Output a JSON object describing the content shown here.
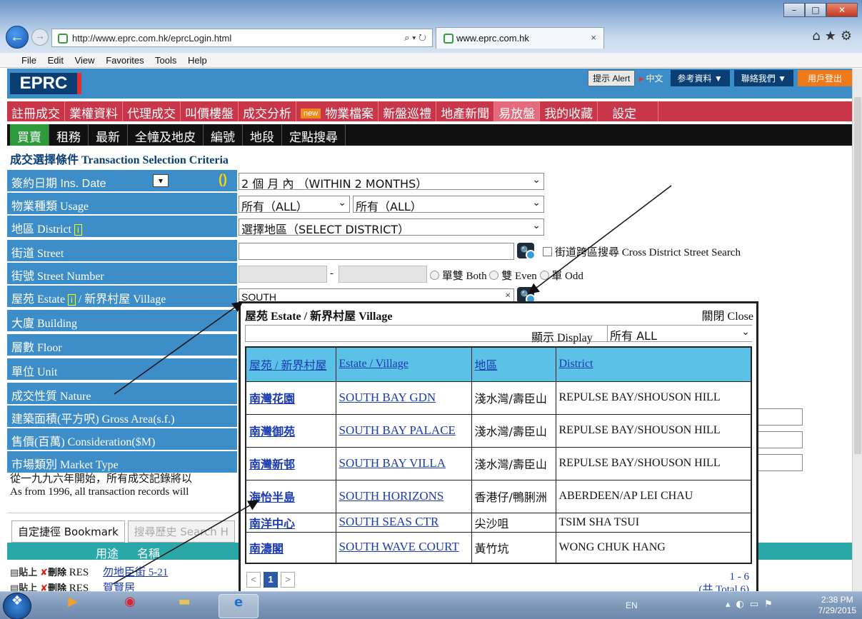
{
  "browser": {
    "url": "http://www.eprc.com.hk/eprcLogin.html",
    "tab_title": "www.eprc.com.hk",
    "menu": [
      "File",
      "Edit",
      "View",
      "Favorites",
      "Tools",
      "Help"
    ]
  },
  "header": {
    "logo": "EPRC",
    "alert": "提示 Alert",
    "lang": "中文",
    "reference": "参考資料 ▼",
    "contact": "聯絡我們 ▼",
    "logout": "用戶登出"
  },
  "nav1": {
    "items": [
      "註冊成交",
      "業權資料",
      "代理成交",
      "叫價樓盤",
      "成交分析",
      "物業檔案",
      "新盤巡禮",
      "地產新聞",
      "易放盤",
      "我的收藏",
      "設定"
    ],
    "new_badge": "new"
  },
  "nav2": {
    "items": [
      "買賣",
      "租務",
      "最新",
      "全幢及地皮",
      "編號",
      "地段",
      "定點搜尋"
    ]
  },
  "criteria": {
    "title": "成交選擇條件 Transaction Selection Criteria",
    "labels": {
      "ins_date": "簽約日期 Ins. Date",
      "usage": "物業種類 Usage",
      "district": "地區 District",
      "street": "街道 Street",
      "street_number": "街號 Street Number",
      "estate": "屋苑 Estate",
      "village": "/ 新界村屋 Village",
      "building": "大廈 Building",
      "floor": "層數 Floor",
      "unit": "單位 Unit",
      "nature": "成交性質 Nature",
      "gross_area": "建築面積(平方呎) Gross Area(s.f.)",
      "consideration": "售價(百萬) Consideration($M)",
      "market_type": "市場類別 Market Type"
    },
    "info_mark": "i",
    "date_value": "2 個 月 內 （WITHIN 2 MONTHS）",
    "usage_value_1": "所有（ALL）",
    "usage_value_2": "所有（ALL）",
    "district_value": "選擇地區（SELECT DISTRICT）",
    "street_value": "",
    "cross_district": "街道跨區搜尋 Cross District Street Search",
    "street_num_sep": "-",
    "both": "單雙 Both",
    "even": "雙 Even",
    "odd": "單 Odd",
    "estate_value": "SOUTH",
    "clear_x": "×"
  },
  "notice": {
    "zh": "從一九九六年開始，所有成交記錄將以",
    "en": "As from 1996, all transaction records will"
  },
  "bookmarks": {
    "tab_bookmark": "自定捷徑 Bookmark",
    "tab_history": "搜尋歷史 Search H",
    "col_usage": "用途",
    "col_name": "名稱",
    "paste": "貼上",
    "delete": "刪除",
    "rows": [
      {
        "type": "RES",
        "name": "勿地臣街 5-21"
      },
      {
        "type": "RES",
        "name": "賀賢居"
      }
    ]
  },
  "popup": {
    "title": "屋苑 Estate / 新界村屋 Village",
    "close": "關閉 Close",
    "display_label": "顯示 Display",
    "display_value": "所有 ALL",
    "columns": [
      "屋苑 / 新界村屋",
      "Estate / Village",
      "地區",
      "District"
    ],
    "rows": [
      {
        "zh": "南灣花園",
        "en": "SOUTH BAY GDN",
        "area_zh": "淺水灣/壽臣山",
        "area_en": "REPULSE BAY/SHOUSON HILL"
      },
      {
        "zh": "南灣御苑",
        "en": "SOUTH BAY PALACE",
        "area_zh": "淺水灣/壽臣山",
        "area_en": "REPULSE BAY/SHOUSON HILL"
      },
      {
        "zh": "南灣新邨",
        "en": "SOUTH BAY VILLA",
        "area_zh": "淺水灣/壽臣山",
        "area_en": "REPULSE BAY/SHOUSON HILL"
      },
      {
        "zh": "海怡半島",
        "en": "SOUTH HORIZONS",
        "area_zh": "香港仔/鴨脷洲",
        "area_en": "ABERDEEN/AP LEI CHAU"
      },
      {
        "zh": "南洋中心",
        "en": "SOUTH SEAS CTR",
        "area_zh": "尖沙咀",
        "area_en": "TSIM SHA TSUI"
      },
      {
        "zh": "南濤閣",
        "en": "SOUTH WAVE COURT",
        "area_zh": "黃竹坑",
        "area_en": "WONG CHUK HANG"
      }
    ],
    "page_prev": "<",
    "page_current": "1",
    "page_next": ">",
    "range": "1 - 6",
    "total": "(共 Total 6)"
  },
  "taskbar": {
    "lang": "EN",
    "time": "2:38 PM",
    "date": "7/29/2015"
  },
  "colors": {
    "header_blue": "#3d8dc8",
    "nav_red": "#c9364a",
    "nav_green": "#2d9b3c",
    "table_head": "#5cc1e6"
  }
}
